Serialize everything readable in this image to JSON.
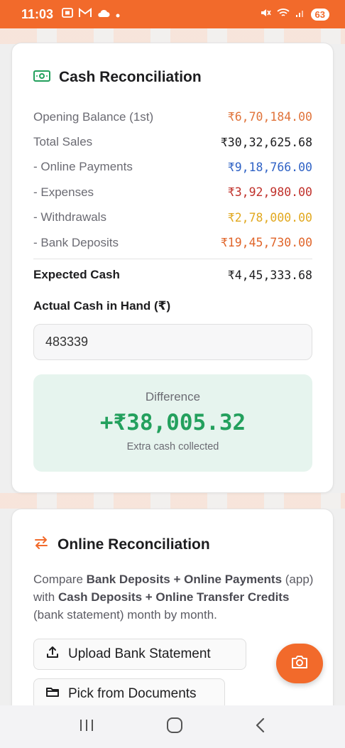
{
  "status_bar": {
    "time": "11:03",
    "battery": "63",
    "left_icons": [
      "screenshot-icon",
      "gmail-icon",
      "cloud-icon",
      "dot-icon"
    ],
    "right_icons": [
      "mute-icon",
      "wifi-icon",
      "signal-icon"
    ],
    "bg_color": "#f26a2b"
  },
  "cash_card": {
    "title": "Cash Reconciliation",
    "rows": [
      {
        "label": "Opening Balance (1st)",
        "amount": "₹6,70,184.00",
        "color": "#e0733a"
      },
      {
        "label": "Total Sales",
        "amount": "₹30,32,625.68",
        "color": "#1d1d1f"
      },
      {
        "label": "- Online Payments",
        "amount": "₹9,18,766.00",
        "color": "#2f62c5"
      },
      {
        "label": "- Expenses",
        "amount": "₹3,92,980.00",
        "color": "#c0312b"
      },
      {
        "label": "- Withdrawals",
        "amount": "₹2,78,000.00",
        "color": "#e1a81f"
      },
      {
        "label": "- Bank Deposits",
        "amount": "₹19,45,730.00",
        "color": "#e0652a"
      }
    ],
    "expected_label": "Expected Cash",
    "expected_amount": "₹4,45,333.68",
    "actual_label": "Actual Cash in Hand (₹)",
    "actual_value": "483339",
    "difference_label": "Difference",
    "difference_value": "+₹38,005.32",
    "difference_note": "Extra cash collected",
    "difference_color": "#23a05d"
  },
  "online_card": {
    "title": "Online Reconciliation",
    "desc": {
      "t1": "Compare ",
      "b1": "Bank Deposits + Online Payments",
      "t2": " (app) with ",
      "b2": "Cash Deposits + Online Transfer Credits",
      "t3": " (bank statement) month by month."
    },
    "upload_label": "Upload Bank Statement",
    "pick_label": "Pick from Documents"
  },
  "fab": {
    "icon": "camera-icon"
  },
  "nav": {
    "icons": [
      "recents-icon",
      "home-icon",
      "back-icon"
    ]
  },
  "accent_color": "#f26a2b"
}
